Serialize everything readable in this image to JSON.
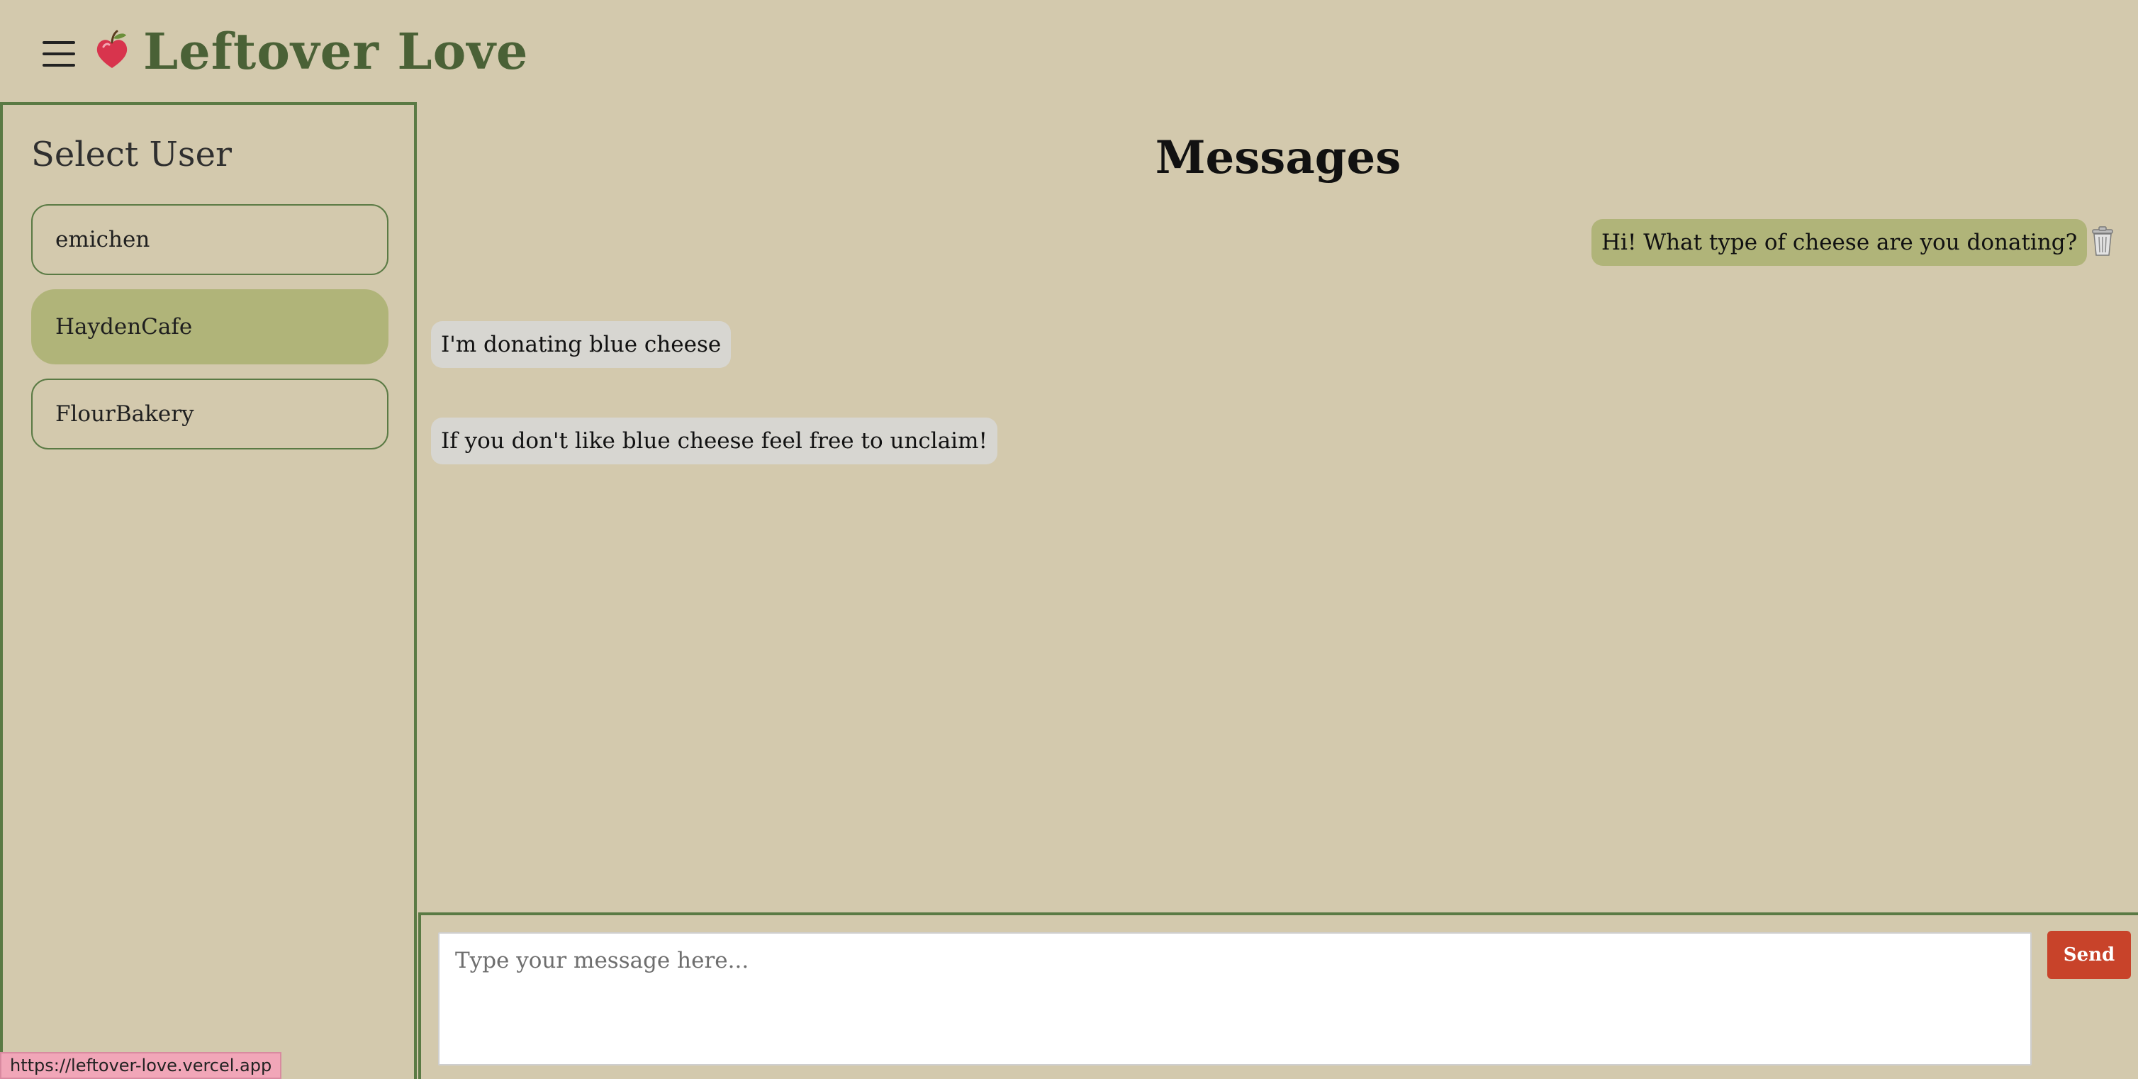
{
  "header": {
    "brand_name": "Leftover Love",
    "menu_icon": "hamburger-menu-icon",
    "logo_icon": "apple-heart-icon"
  },
  "sidebar": {
    "title": "Select User",
    "users": [
      {
        "label": "emichen",
        "active": false
      },
      {
        "label": "HaydenCafe",
        "active": true
      },
      {
        "label": "FlourBakery",
        "active": false
      }
    ]
  },
  "main": {
    "title": "Messages",
    "messages": [
      {
        "text": "Hi! What type of cheese are you donating?",
        "direction": "sent"
      },
      {
        "text": "I'm donating blue cheese",
        "direction": "received"
      },
      {
        "text": "If you don't like blue cheese feel free to unclaim!",
        "direction": "received"
      }
    ],
    "delete_icon": "trash-icon"
  },
  "composer": {
    "placeholder": "Type your message here...",
    "value": "",
    "send_label": "Send"
  },
  "status_bar": {
    "url": "https://leftover-love.vercel.app"
  },
  "colors": {
    "background": "#d3c9ad",
    "brand_green": "#4a6136",
    "border_green": "#5a7a44",
    "active_olive": "#b0b479",
    "received_bubble": "#d7d6d1",
    "send_button": "#c8432a"
  }
}
